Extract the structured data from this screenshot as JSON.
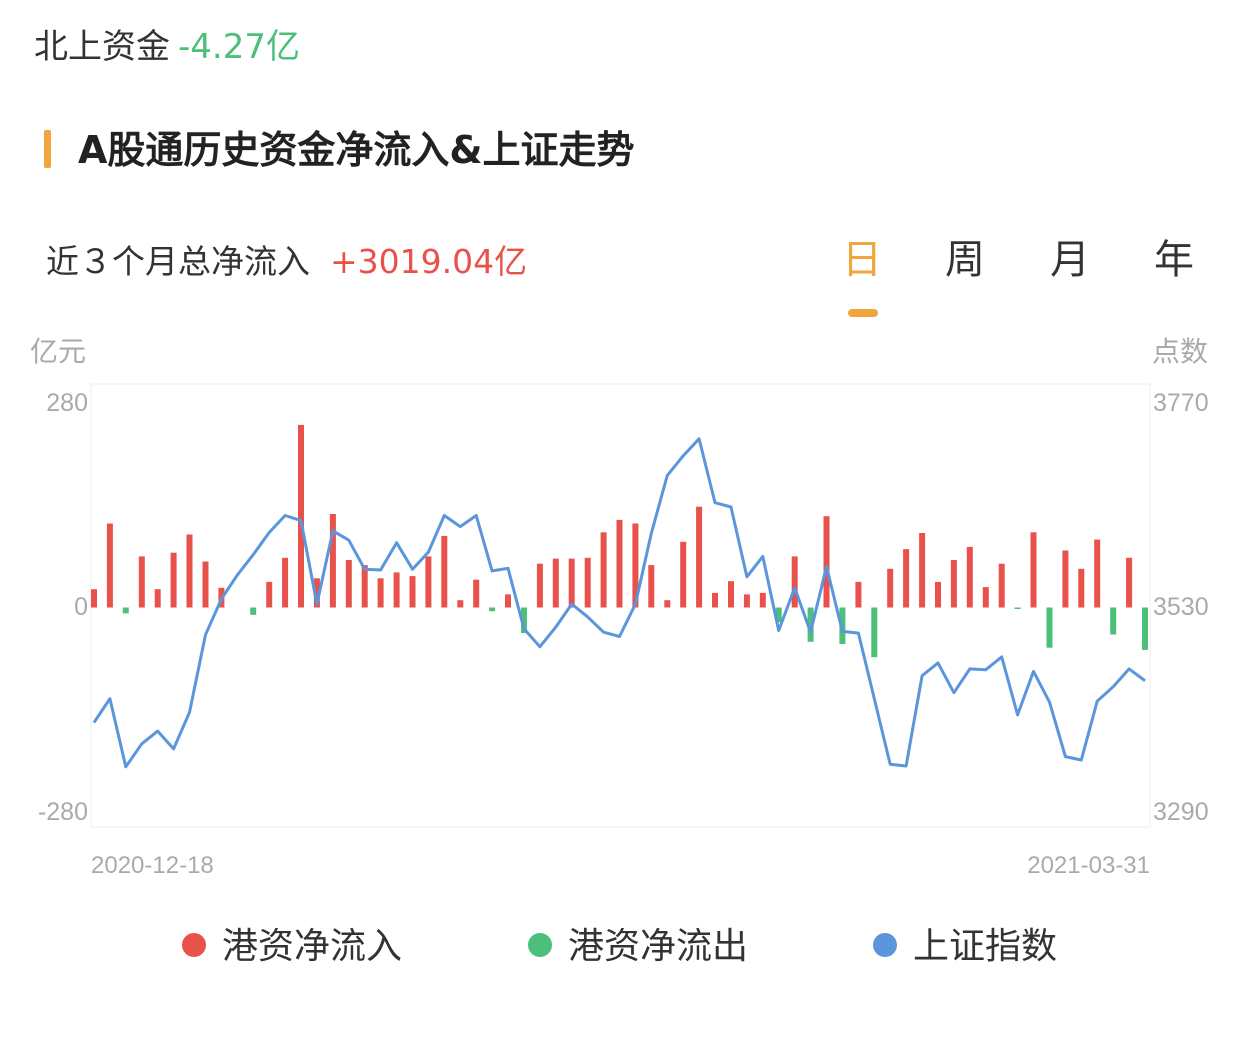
{
  "header": {
    "label": "北上资金",
    "value": "-4.27亿"
  },
  "section": {
    "title": "A股通历史资金净流入&上证走势"
  },
  "summary": {
    "label": "近３个月总净流入",
    "value": "+3019.04亿"
  },
  "tabs": [
    {
      "label": "日",
      "active": true
    },
    {
      "label": "周",
      "active": false
    },
    {
      "label": "月",
      "active": false
    },
    {
      "label": "年",
      "active": false
    }
  ],
  "colors": {
    "accent": "#f0a63c",
    "inflow": "#e8524a",
    "outflow": "#4cbf78",
    "index_line": "#5b95dc"
  },
  "chart_data": {
    "type": "bar",
    "left_unit": "亿元",
    "right_unit": "点数",
    "left_ticks": [
      "280",
      "0",
      "-280"
    ],
    "right_ticks": [
      "3770",
      "3530",
      "3290"
    ],
    "y_left_range": [
      -280,
      280
    ],
    "y_right_range": [
      3290,
      3770
    ],
    "x_start": "2020-12-18",
    "x_end": "2021-03-31",
    "series": [
      {
        "name": "港资净流入",
        "values": [
          25,
          115,
          -8,
          70,
          25,
          75,
          100,
          63,
          27,
          0,
          -10,
          35,
          68,
          250,
          40,
          128,
          65,
          58,
          40,
          48,
          43,
          70,
          98,
          10,
          38,
          -5,
          18,
          -35,
          60,
          67,
          67,
          68,
          103,
          120,
          115,
          58,
          10,
          90,
          138,
          20,
          36,
          18,
          20,
          -20,
          70,
          -47,
          125,
          -50,
          35,
          -68,
          53,
          80,
          102,
          35,
          65,
          83,
          28,
          60,
          -2,
          103,
          -55,
          78,
          53,
          93,
          -37,
          68,
          -58
        ]
      },
      {
        "name": "上证指数",
        "values": [
          3395,
          3423,
          3343,
          3370,
          3385,
          3364,
          3407,
          3498,
          3540,
          3568,
          3592,
          3618,
          3638,
          3632,
          3534,
          3620,
          3609,
          3575,
          3574,
          3606,
          3575,
          3595,
          3638,
          3625,
          3638,
          3573,
          3576,
          3505,
          3484,
          3507,
          3534,
          3519,
          3501,
          3496,
          3534,
          3617,
          3685,
          3708,
          3728,
          3653,
          3648,
          3566,
          3590,
          3503,
          3553,
          3501,
          3578,
          3502,
          3500,
          3423,
          3346,
          3344,
          3450,
          3465,
          3430,
          3458,
          3457,
          3472,
          3404,
          3455,
          3419,
          3355,
          3351,
          3420,
          3437,
          3458,
          3444
        ]
      }
    ],
    "legend": [
      {
        "label": "港资净流入",
        "color": "#e8524a"
      },
      {
        "label": "港资净流出",
        "color": "#4cbf78"
      },
      {
        "label": "上证指数",
        "color": "#5b95dc"
      }
    ],
    "legend_position": "bottom",
    "grid": false
  }
}
